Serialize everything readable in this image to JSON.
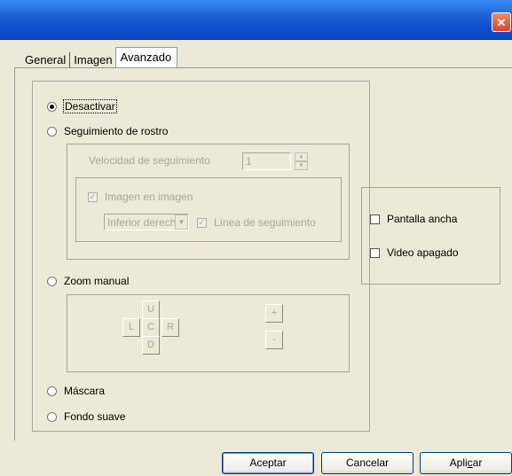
{
  "window": {
    "close_glyph": "✕"
  },
  "tabs": [
    {
      "label": "General"
    },
    {
      "label": "Imagen"
    },
    {
      "label": "Avanzado"
    }
  ],
  "left_panel": {
    "radio_desactivar": "Desactivar",
    "radio_seguimiento": "Seguimiento de rostro",
    "velocidad_label": "Velocidad de seguimiento",
    "velocidad_value": "1",
    "imagen_en_imagen": "Imagen en imagen",
    "posicion_value": "Inferior derecho",
    "linea_seguimiento": "Línea de seguimiento",
    "radio_zoom": "Zoom manual",
    "pad": {
      "up": "U",
      "left": "L",
      "center": "C",
      "right": "R",
      "down": "D"
    },
    "zoom_plus": "+",
    "zoom_minus": "-",
    "radio_mascara": "Máscara",
    "radio_fondo": "Fondo suave"
  },
  "right_panel": {
    "pantalla_ancha": "Pantalla ancha",
    "video_apagado": "Video apagado"
  },
  "buttons": {
    "aceptar": "Aceptar",
    "cancelar": "Cancelar",
    "aplicar_pre": "Apli",
    "aplicar_mnemonic": "c",
    "aplicar_post": "ar"
  },
  "colors": {
    "titlebar": "#0a46c4",
    "dialog_bg": "#ece9d8",
    "disabled_text": "#aaa79b"
  }
}
